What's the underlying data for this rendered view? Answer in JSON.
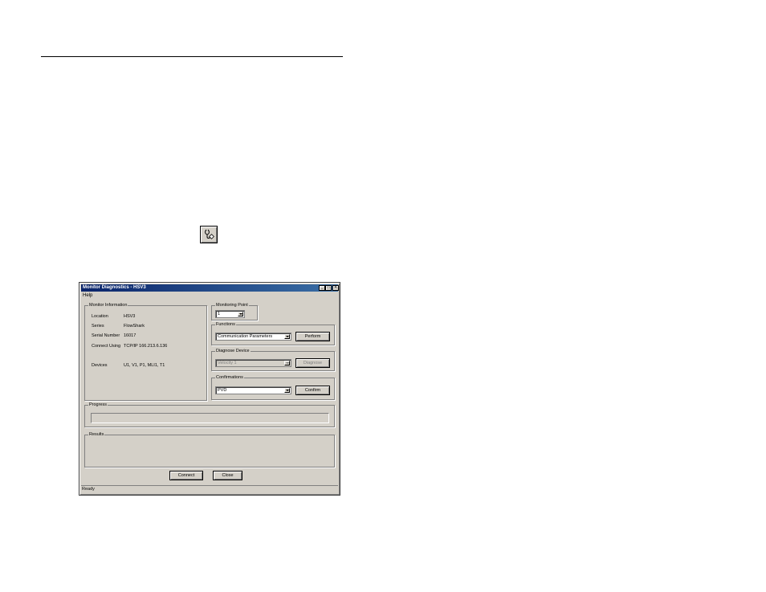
{
  "window": {
    "title": "Monitor Diagnostics - HSV3",
    "menu": {
      "help": "Help"
    },
    "controls": {
      "minimize": "_",
      "maximize": "□",
      "close": "✕"
    }
  },
  "monitor_info": {
    "legend": "Monitor Information",
    "rows": [
      {
        "label": "Location",
        "value": "HSV3"
      },
      {
        "label": "Series",
        "value": "FlowShark"
      },
      {
        "label": "Serial Number",
        "value": "16017"
      },
      {
        "label": "Connect Using",
        "value": "TCP/IP 166.213.6.136"
      },
      {
        "label": "Devices",
        "value": "U1, V1, P1, MLI1, T1"
      }
    ]
  },
  "monitoring_point": {
    "legend": "Monitoring Point",
    "value": "1"
  },
  "functions": {
    "legend": "Functions",
    "value": "Communication Parameters",
    "button": "Perform"
  },
  "diagnose_device": {
    "legend": "Diagnose Device",
    "value": "Velocity 1",
    "button": "Diagnose"
  },
  "confirmations": {
    "legend": "Confirmations",
    "value": "PVD",
    "button": "Confirm"
  },
  "progress": {
    "legend": "Progress",
    "value": 0
  },
  "results": {
    "legend": "Results"
  },
  "footer": {
    "connect": "Connect",
    "close": "Close"
  },
  "status": "Ready",
  "icons": {
    "toolbar_icon": "diagnostics-stethoscope-icon"
  }
}
